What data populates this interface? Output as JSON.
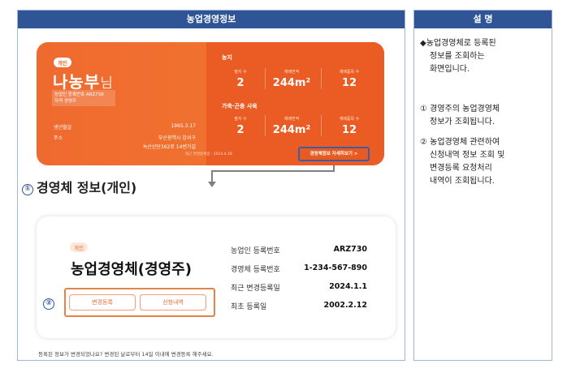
{
  "left_panel": {
    "header": "농업경영정보"
  },
  "right_panel": {
    "header": "설 명"
  },
  "summary_card": {
    "tag": "개인",
    "name": "나농부",
    "name_suffix": "님",
    "reg_line1": "농업인 등록번호 ARZ730",
    "reg_line2": "자격 경영주",
    "birth_label": "생년월일",
    "birth_value": "1965.3.17",
    "address_label": "주소",
    "address_line1": "부산광역시 강서구",
    "address_line2": "녹산산단362로 14번가길",
    "farmland": {
      "title": "농지",
      "stats": [
        {
          "label": "필지 수",
          "value": "2"
        },
        {
          "label": "재배면적",
          "value": "244m²"
        },
        {
          "label": "재배품목 수",
          "value": "12"
        }
      ]
    },
    "livestock": {
      "title": "가축·곤충 사육",
      "stats": [
        {
          "label": "필지 수",
          "value": "2"
        },
        {
          "label": "재배면적",
          "value": "244m²"
        },
        {
          "label": "재배품목 수",
          "value": "12"
        }
      ]
    },
    "last_updated": "최근 변경등록일 : 2024.4.18",
    "detail_button": "경영체정보 자세히보기 >"
  },
  "section1": {
    "number": "①",
    "title": "경영체 정보(개인)"
  },
  "detail_card": {
    "tag": "개인",
    "title": "농업경영체(경영주)",
    "number": "②",
    "change_button": "변경등록",
    "history_button": "신청내역",
    "rows": [
      {
        "label": "농업인 등록번호",
        "value": "ARZ730"
      },
      {
        "label": "경영체 등록번호",
        "value": "1-234-567-890"
      },
      {
        "label": "최근 변경등록일",
        "value": "2024.1.1"
      },
      {
        "label": "최초 등록일",
        "value": "2002.2.12"
      }
    ]
  },
  "footnote": "등록된 정보가 변경되었나요? 변경된 날로부터 14일 이내에 변경등록 해주세요.",
  "description": {
    "bullet": [
      "◆농업경영체로 등록된",
      "정보를 조회하는",
      "화면입니다."
    ],
    "item1": [
      "① 경영주의 농업경영체",
      "정보가 조회됩니다."
    ],
    "item2": [
      "② 농업경영체 관련하여",
      "신청내역 정보 조회 및",
      "변경등록 요청처리",
      "내역이 조회됩니다."
    ]
  }
}
